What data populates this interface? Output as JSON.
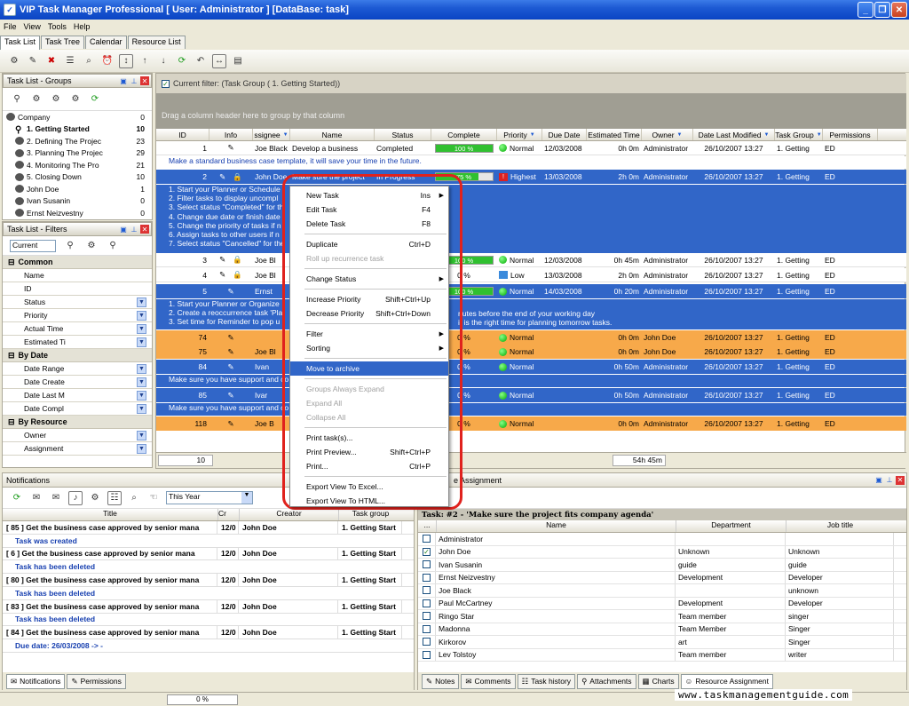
{
  "window": {
    "title": "VIP Task Manager Professional [ User: Administrator ] [DataBase: task]"
  },
  "menu": [
    "File",
    "View",
    "Tools",
    "Help"
  ],
  "main_tabs": [
    "Task List",
    "Task Tree",
    "Calendar",
    "Resource List"
  ],
  "groups_panel": {
    "title": "Task List - Groups",
    "items": [
      {
        "label": "Company",
        "count": "0"
      },
      {
        "label": "1. Getting Started",
        "count": "10"
      },
      {
        "label": "2. Defining The Projec",
        "count": "23"
      },
      {
        "label": "3. Planning The Projec",
        "count": "29"
      },
      {
        "label": "4. Monitoring The Pro",
        "count": "21"
      },
      {
        "label": "5. Closing Down",
        "count": "10"
      },
      {
        "label": "John Doe",
        "count": "1"
      },
      {
        "label": "Ivan Susanin",
        "count": "0"
      },
      {
        "label": "Ernst Neizvestny",
        "count": "0"
      }
    ]
  },
  "filters_panel": {
    "title": "Task List - Filters",
    "current": "Current",
    "sections": [
      {
        "name": "Common",
        "items": [
          "Name",
          "ID",
          "Status",
          "Priority",
          "Actual Time",
          "Estimated Ti"
        ]
      },
      {
        "name": "By Date",
        "items": [
          "Date Range",
          "Date Create",
          "Date Last M",
          "Date Compl"
        ]
      },
      {
        "name": "By Resource",
        "items": [
          "Owner",
          "Assignment"
        ]
      }
    ]
  },
  "grid": {
    "filter_label": "Current filter: (Task Group  ( 1. Getting Started))",
    "group_hint": "Drag a column header here to group by that column",
    "columns": [
      "ID",
      "Info",
      "ssignee",
      "Name",
      "Status",
      "Complete",
      "Priority",
      "Due Date",
      "Estimated Time",
      "Owner",
      "Date Last Modified",
      "Task Group",
      "Permissions"
    ],
    "rows": [
      {
        "id": "1",
        "assignee": "Joe Black",
        "name": "Develop a business",
        "status": "Completed",
        "complete": "100 %",
        "pct": 100,
        "priority": "Normal",
        "due": "12/03/2008",
        "est": "0h 0m",
        "owner": "Administrator",
        "modified": "26/10/2007 13:27",
        "group": "1. Getting",
        "perm": "ED",
        "style": "white"
      },
      {
        "id": "2",
        "assignee": "John Doe",
        "name": "Make sure the project",
        "status": "In Progress",
        "complete": "75 %",
        "pct": 75,
        "priority": "Highest",
        "due": "13/03/2008",
        "est": "2h 0m",
        "owner": "Administrator",
        "modified": "26/10/2007 13:27",
        "group": "1. Getting",
        "perm": "ED",
        "style": "blue"
      },
      {
        "id": "3",
        "assignee": "Joe Bl",
        "name": "",
        "status": "",
        "complete": "100 %",
        "pct": 100,
        "priority": "Normal",
        "due": "12/03/2008",
        "est": "0h 45m",
        "owner": "Administrator",
        "modified": "26/10/2007 13:27",
        "group": "1. Getting",
        "perm": "ED",
        "style": "white"
      },
      {
        "id": "4",
        "assignee": "Joe Bl",
        "name": "",
        "status": "",
        "complete": "0 %",
        "pct": 0,
        "priority": "Low",
        "due": "13/03/2008",
        "est": "2h 0m",
        "owner": "Administrator",
        "modified": "26/10/2007 13:27",
        "group": "1. Getting",
        "perm": "ED",
        "style": "white"
      },
      {
        "id": "5",
        "assignee": "Ernst",
        "name": "",
        "status": "",
        "complete": "100 %",
        "pct": 100,
        "priority": "Normal",
        "due": "14/03/2008",
        "est": "0h 20m",
        "owner": "Administrator",
        "modified": "26/10/2007 13:27",
        "group": "1. Getting",
        "perm": "ED",
        "style": "blue"
      },
      {
        "id": "74",
        "assignee": "",
        "name": "",
        "status": "",
        "complete": "0 %",
        "pct": 0,
        "priority": "Normal",
        "due": "",
        "est": "0h 0m",
        "owner": "John Doe",
        "modified": "26/10/2007 13:27",
        "group": "1. Getting",
        "perm": "ED",
        "style": "orange"
      },
      {
        "id": "75",
        "assignee": "Joe Bl",
        "name": "",
        "status": "",
        "complete": "0 %",
        "pct": 0,
        "priority": "Normal",
        "due": "",
        "est": "0h 0m",
        "owner": "John Doe",
        "modified": "26/10/2007 13:27",
        "group": "1. Getting",
        "perm": "ED",
        "style": "orange"
      },
      {
        "id": "84",
        "assignee": "Ivan",
        "name": "",
        "status": "",
        "complete": "0 %",
        "pct": 0,
        "priority": "Normal",
        "due": "",
        "est": "0h 50m",
        "owner": "Administrator",
        "modified": "26/10/2007 13:27",
        "group": "1. Getting",
        "perm": "ED",
        "style": "blue"
      },
      {
        "id": "85",
        "assignee": "Ivar",
        "name": "",
        "status": "",
        "complete": "0 %",
        "pct": 0,
        "priority": "Normal",
        "due": "",
        "est": "0h 50m",
        "owner": "Administrator",
        "modified": "26/10/2007 13:27",
        "group": "1. Getting",
        "perm": "ED",
        "style": "blue"
      },
      {
        "id": "118",
        "assignee": "Joe B",
        "name": "",
        "status": "",
        "complete": "0 %",
        "pct": 0,
        "priority": "Normal",
        "due": "",
        "est": "0h 0m",
        "owner": "Administrator",
        "modified": "26/10/2007 13:27",
        "group": "1. Getting",
        "perm": "ED",
        "style": "orange"
      }
    ],
    "desc_row1": "Make a standard business case template, it will save your time in the future.",
    "desc_block2": [
      "1. Start your Planner or Schedule",
      "2. Filter tasks to display uncompl",
      "3. Select status \"Completed\" for th",
      "4. Change due date or finish date",
      "5. Change the priority of tasks if n",
      "6. Assign tasks to other users if n",
      "7. Select status \"Cancelled\" for the"
    ],
    "desc_block5": [
      "1. Start your Planner or Organize",
      "2. Create a reoccurrence task 'Pla",
      "3. Set time for Reminder to pop u"
    ],
    "desc_block5_right": [
      "",
      "nutes before the end of your working day",
      "it is the right time for planning tomorrow tasks."
    ],
    "desc_84": "Make sure you have support and co",
    "desc_85": "Make sure you have support and co",
    "footer_count": "10",
    "footer_total": "54h 45m"
  },
  "context_menu": [
    {
      "label": "New Task",
      "shortcut": "Ins",
      "arrow": true
    },
    {
      "label": "Edit Task",
      "shortcut": "F4"
    },
    {
      "label": "Delete Task",
      "shortcut": "F8"
    },
    {
      "sep": true
    },
    {
      "label": "Duplicate",
      "shortcut": "Ctrl+D"
    },
    {
      "label": "Roll up recurrence task",
      "disabled": true
    },
    {
      "sep": true
    },
    {
      "label": "Change Status",
      "arrow": true
    },
    {
      "sep": true
    },
    {
      "label": "Increase Priority",
      "shortcut": "Shift+Ctrl+Up"
    },
    {
      "label": "Decrease Priority",
      "shortcut": "Shift+Ctrl+Down"
    },
    {
      "sep": true
    },
    {
      "label": "Filter",
      "arrow": true
    },
    {
      "label": "Sorting",
      "arrow": true
    },
    {
      "sep": true
    },
    {
      "label": "Move to archive",
      "highlighted": true
    },
    {
      "sep": true
    },
    {
      "label": "Groups Always Expand",
      "disabled": true
    },
    {
      "label": "Expand All",
      "disabled": true
    },
    {
      "label": "Collapse All",
      "disabled": true
    },
    {
      "sep": true
    },
    {
      "label": "Print task(s)..."
    },
    {
      "label": "Print Preview...",
      "shortcut": "Shift+Ctrl+P"
    },
    {
      "label": "Print...",
      "shortcut": "Ctrl+P"
    },
    {
      "sep": true
    },
    {
      "label": "Export View To Excel..."
    },
    {
      "label": "Export View To HTML..."
    }
  ],
  "notifications": {
    "title": "Notifications",
    "period": "This Year",
    "columns": [
      "Title",
      "Cr",
      "Creator",
      "Task group"
    ],
    "rows": [
      {
        "title": "[ 85 ] Get the business case approved by senior mana",
        "cr": "12/0",
        "creator": "John Doe",
        "group": "1. Getting Start",
        "sub": "Task was created"
      },
      {
        "title": "[ 6 ] Get the business case approved by senior mana",
        "cr": "12/0",
        "creator": "John Doe",
        "group": "1. Getting Start",
        "sub": "Task has been deleted"
      },
      {
        "title": "[ 80 ] Get the business case approved by senior mana",
        "cr": "12/0",
        "creator": "John Doe",
        "group": "1. Getting Start",
        "sub": "Task has been deleted"
      },
      {
        "title": "[ 83 ] Get the business case approved by senior mana",
        "cr": "12/0",
        "creator": "John Doe",
        "group": "1. Getting Start",
        "sub": "Task has been deleted"
      },
      {
        "title": "[ 84 ] Get the business case approved by senior mana",
        "cr": "12/0",
        "creator": "John Doe",
        "group": "1. Getting Start",
        "sub": "Due date: 26/03/2008 -> -"
      }
    ],
    "tabs": [
      "Notifications",
      "Permissions"
    ]
  },
  "resource_assignment": {
    "title": "e Assignment",
    "task_label": "Task: #2 - 'Make sure the project fits company agenda'",
    "columns": [
      "...",
      "Name",
      "Department",
      "Job title"
    ],
    "rows": [
      {
        "name": "Administrator",
        "dept": "",
        "job": "",
        "checked": false
      },
      {
        "name": "John Doe",
        "dept": "Unknown",
        "job": "Unknown",
        "checked": true
      },
      {
        "name": "Ivan Susanin",
        "dept": "guide",
        "job": "guide",
        "checked": false
      },
      {
        "name": "Ernst Neizvestny",
        "dept": "Development",
        "job": "Developer",
        "checked": false
      },
      {
        "name": "Joe Black",
        "dept": "",
        "job": "unknown",
        "checked": false
      },
      {
        "name": "Paul McCartney",
        "dept": "Development",
        "job": "Developer",
        "checked": false
      },
      {
        "name": "Ringo Star",
        "dept": "Team member",
        "job": "singer",
        "checked": false
      },
      {
        "name": "Madonna",
        "dept": "Team Member",
        "job": "Singer",
        "checked": false
      },
      {
        "name": "Kirkorov",
        "dept": "art",
        "job": "Singer",
        "checked": false
      },
      {
        "name": "Lev Tolstoy",
        "dept": "Team member",
        "job": "writer",
        "checked": false
      }
    ],
    "tabs": [
      "Notes",
      "Comments",
      "Task history",
      "Attachments",
      "Charts",
      "Resource Assignment"
    ]
  },
  "statusbar": {
    "progress": "0 %"
  },
  "watermark": "www.taskmanagementguide.com"
}
